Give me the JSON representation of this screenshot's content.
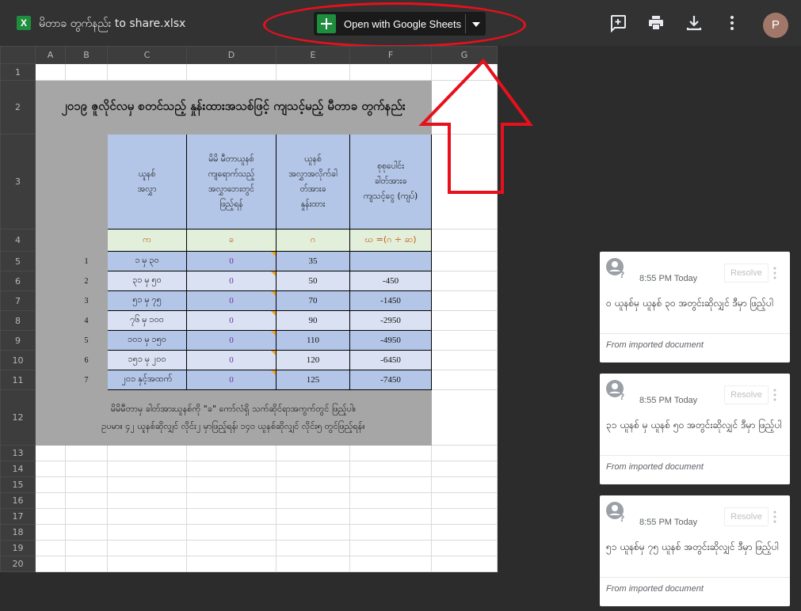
{
  "file": {
    "icon_letter": "X",
    "name": "မိတာခ တွက်နည်း to share.xlsx"
  },
  "toolbar": {
    "open_with_label": "Open with Google Sheets",
    "add_comment_icon": "add-comment-icon",
    "print_icon": "print-icon",
    "download_icon": "download-icon",
    "more_icon": "more-vert-icon",
    "avatar_letter": "P"
  },
  "sheet": {
    "columns": [
      "A",
      "B",
      "C",
      "D",
      "E",
      "F",
      "G"
    ],
    "rows": [
      "1",
      "2",
      "3",
      "4",
      "5",
      "6",
      "7",
      "8",
      "9",
      "10",
      "11",
      "12",
      "13",
      "14",
      "15",
      "16",
      "17",
      "18",
      "19",
      "20"
    ],
    "title": "၂၀၁၉ ဇူလိုင်လမှ စတင်သည့် နှုန်းထားအသစ်ဖြင့် ကျသင့်မည့် မီတာခ တွက်နည်း",
    "headers": [
      "ယူနစ်\nအလွှာ",
      "မိမိ မီတာယူနစ်\nကျရောက်သည့်\nအလွှာဘေးတွင်\nဖြည့်ရန်",
      "ယူနစ်\nအလွှာအလိုက်ခါ\nတ်အားခ\nနှုန်းထား",
      "စုစုပေါင်း\nခါတ်အားခ\nကျသင့်ငွေ (ကျပ်)"
    ],
    "labels": [
      "က",
      "ခ",
      "ဂ",
      "ဃ =(ဂ ÷ ဆ)"
    ],
    "data_rows": [
      {
        "no": "1",
        "tier": "၁ မှ ၃၀",
        "units": "0",
        "rate": "35",
        "total": ""
      },
      {
        "no": "2",
        "tier": "၃၁ မှ ၅၀",
        "units": "0",
        "rate": "50",
        "total": "-450"
      },
      {
        "no": "3",
        "tier": "၅၁ မှ ၇၅",
        "units": "0",
        "rate": "70",
        "total": "-1450"
      },
      {
        "no": "4",
        "tier": "၇၆ မှ ၁၀၀",
        "units": "0",
        "rate": "90",
        "total": "-2950"
      },
      {
        "no": "5",
        "tier": "၁၀၁ မှ ၁၅၀",
        "units": "0",
        "rate": "110",
        "total": "-4950"
      },
      {
        "no": "6",
        "tier": "၁၅၁ မှ ၂၀၀",
        "units": "0",
        "rate": "120",
        "total": "-6450"
      },
      {
        "no": "7",
        "tier": "၂၀၁ နှင့်အထက်",
        "units": "0",
        "rate": "125",
        "total": "-7450"
      }
    ],
    "note_line1": "မိမိမီတာမှ ခါတ်အားယူနစ်ကို \"ခ\" ကော်လံရှိ သက်ဆိုင်ရာအကွက်တွင် ဖြည့်ပါ။",
    "note_line2": "ဥပမာ။ ၄၂ ယူနစ်ဆိုလျှင် လိုင်း၂ မှာဖြည့်ရန်၊ ၁၄၀ ယူနစ်ဆိုလျှင် လိုင်း၅ တွင်ဖြည့်ရန်။"
  },
  "comments": [
    {
      "time": "8:55 PM Today",
      "resolve": "Resolve",
      "text": "ဝ ယူနစ်မှ ယူနစ် ၃၀ အတွင်းဆိုလျှင် ဒီမှာ ဖြည့်ပါ",
      "from": "From imported document"
    },
    {
      "time": "8:55 PM Today",
      "resolve": "Resolve",
      "text": "၃၁ ယူနစ် မှ ယူနစ် ၅၀ အတွင်းဆိုလျှင် ဒီမှာ ဖြည့်ပါ",
      "from": "From imported document"
    },
    {
      "time": "8:55 PM Today",
      "resolve": "Resolve",
      "text": "၅၁ ယူနစ်မှ ၇၅ ယူနစ် အတွင်းဆိုလျှင် ဒီမှာ ဖြည့်ပါ",
      "from": "From imported document"
    }
  ],
  "colors": {
    "header_fill": "#b4c6e7",
    "label_fill": "#e2efda",
    "annotation_red": "#e8101c",
    "sheets_green": "#1e8e3e"
  }
}
